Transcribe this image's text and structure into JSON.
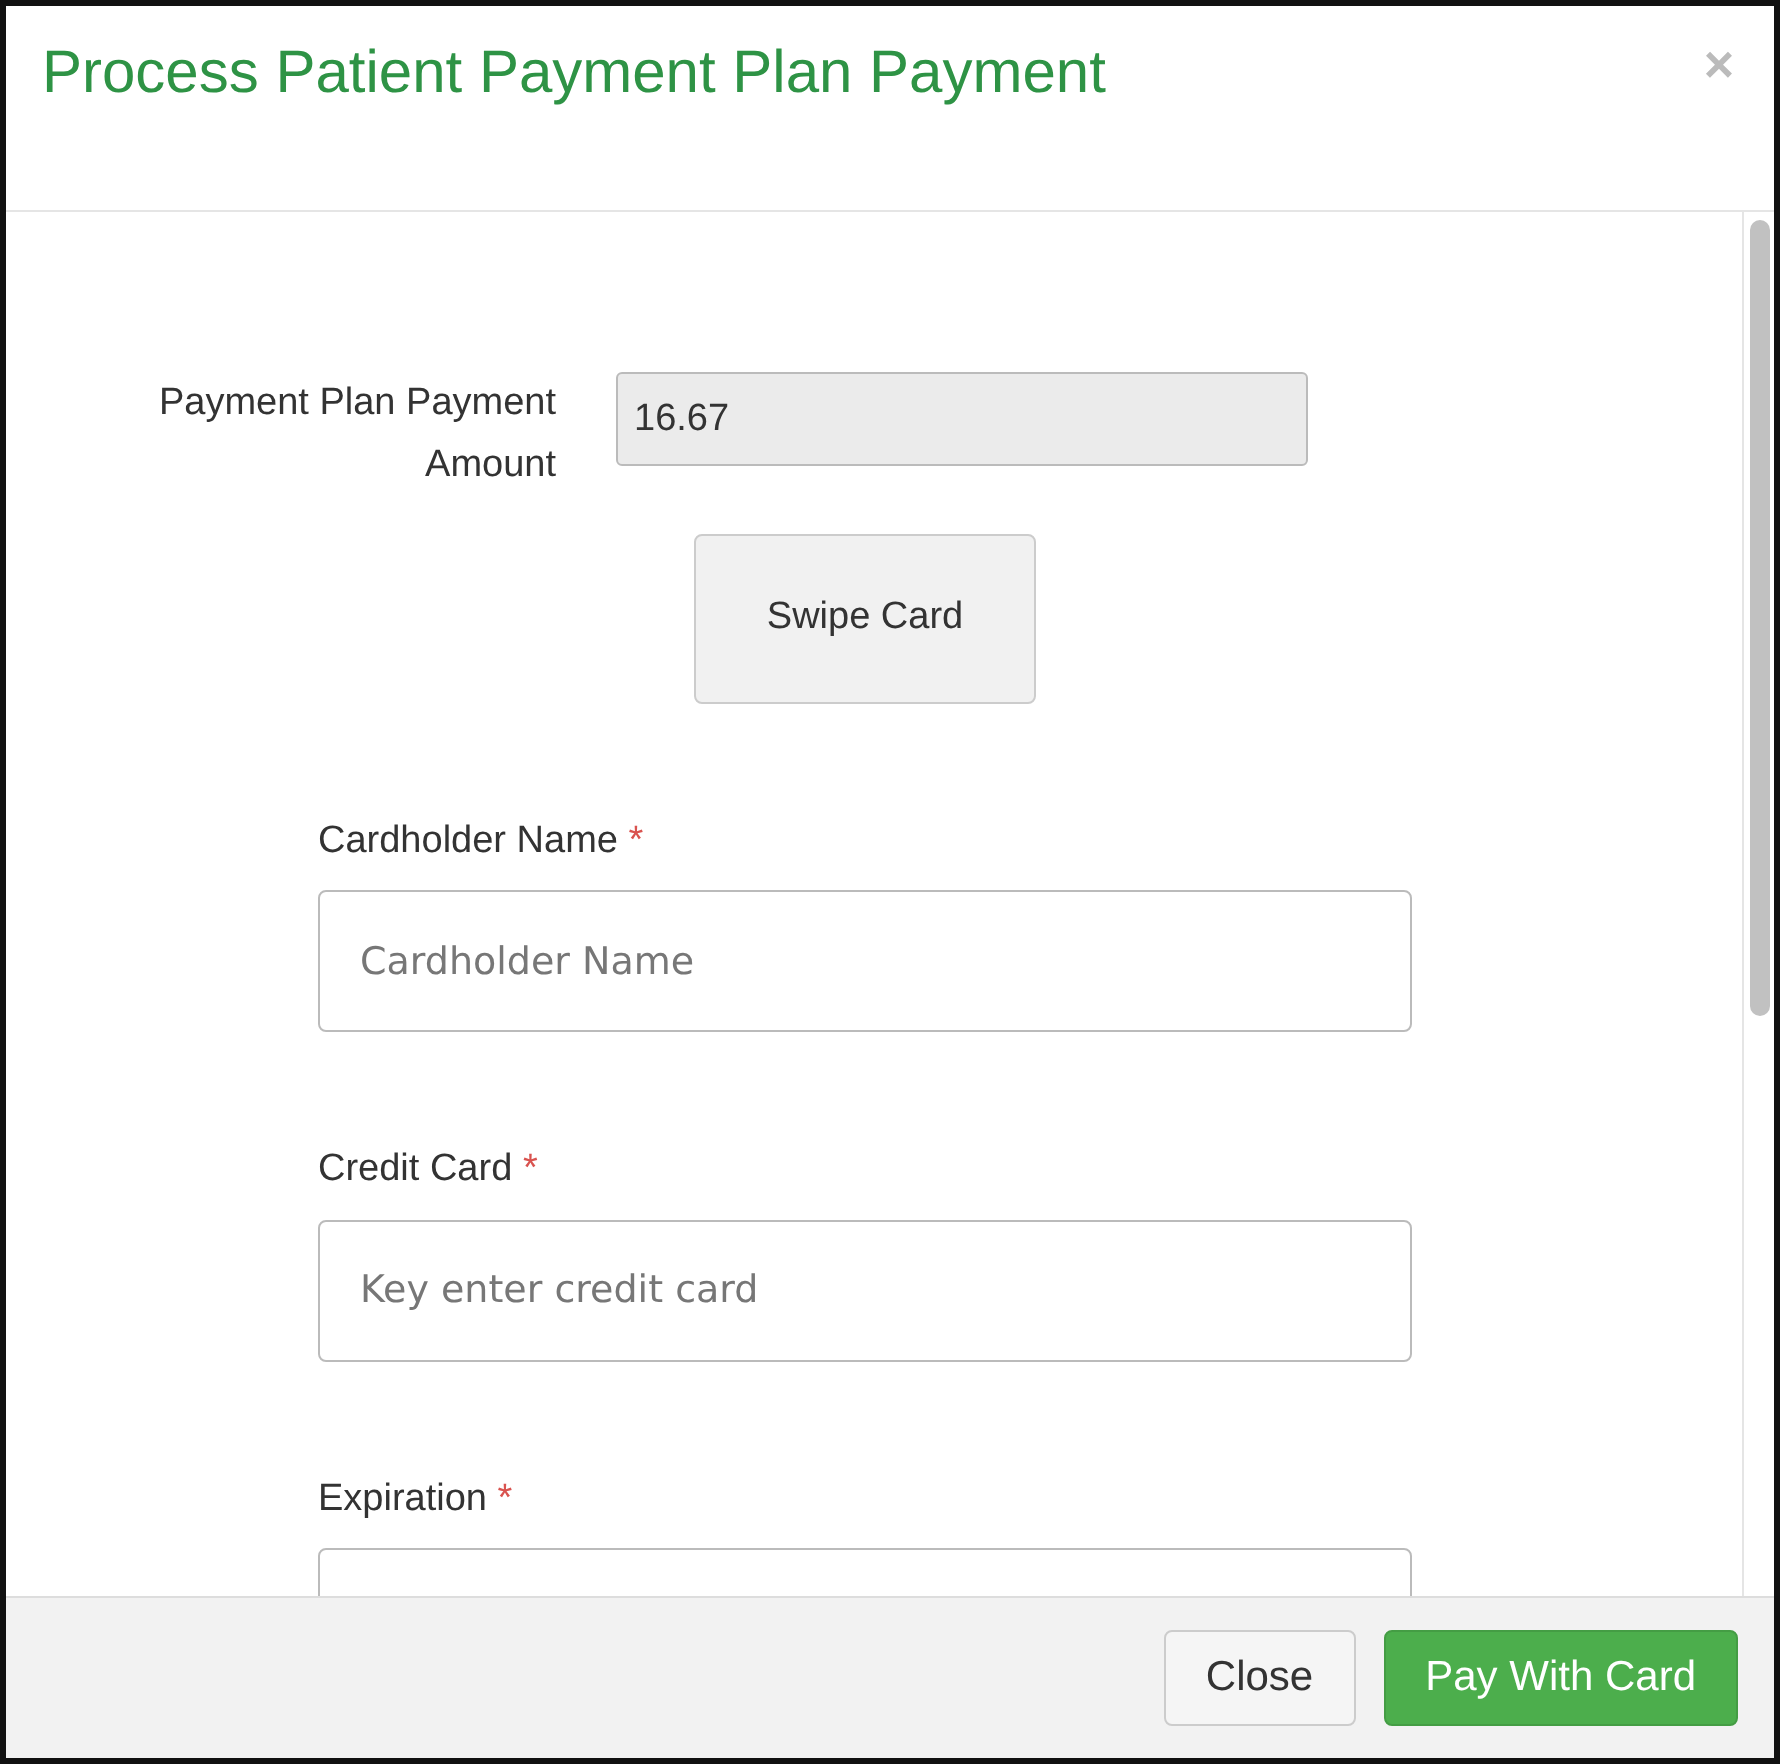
{
  "dialog": {
    "title": "Process Patient Payment Plan Payment",
    "close_glyph": "×"
  },
  "amount": {
    "label": "Payment Plan Payment Amount",
    "value": "16.67",
    "disabled": true
  },
  "swipe_button": "Swipe Card",
  "fields": [
    {
      "label": "Cardholder Name",
      "required": true,
      "placeholder": "Cardholder Name"
    },
    {
      "label": "Credit Card",
      "required": true,
      "placeholder": "Key enter credit card"
    },
    {
      "label": "Expiration",
      "required": true
    }
  ],
  "required_mark": "*",
  "footer_buttons": [
    {
      "label": "Close",
      "kind": "secondary"
    },
    {
      "label": "Pay With Card",
      "kind": "primary"
    }
  ]
}
